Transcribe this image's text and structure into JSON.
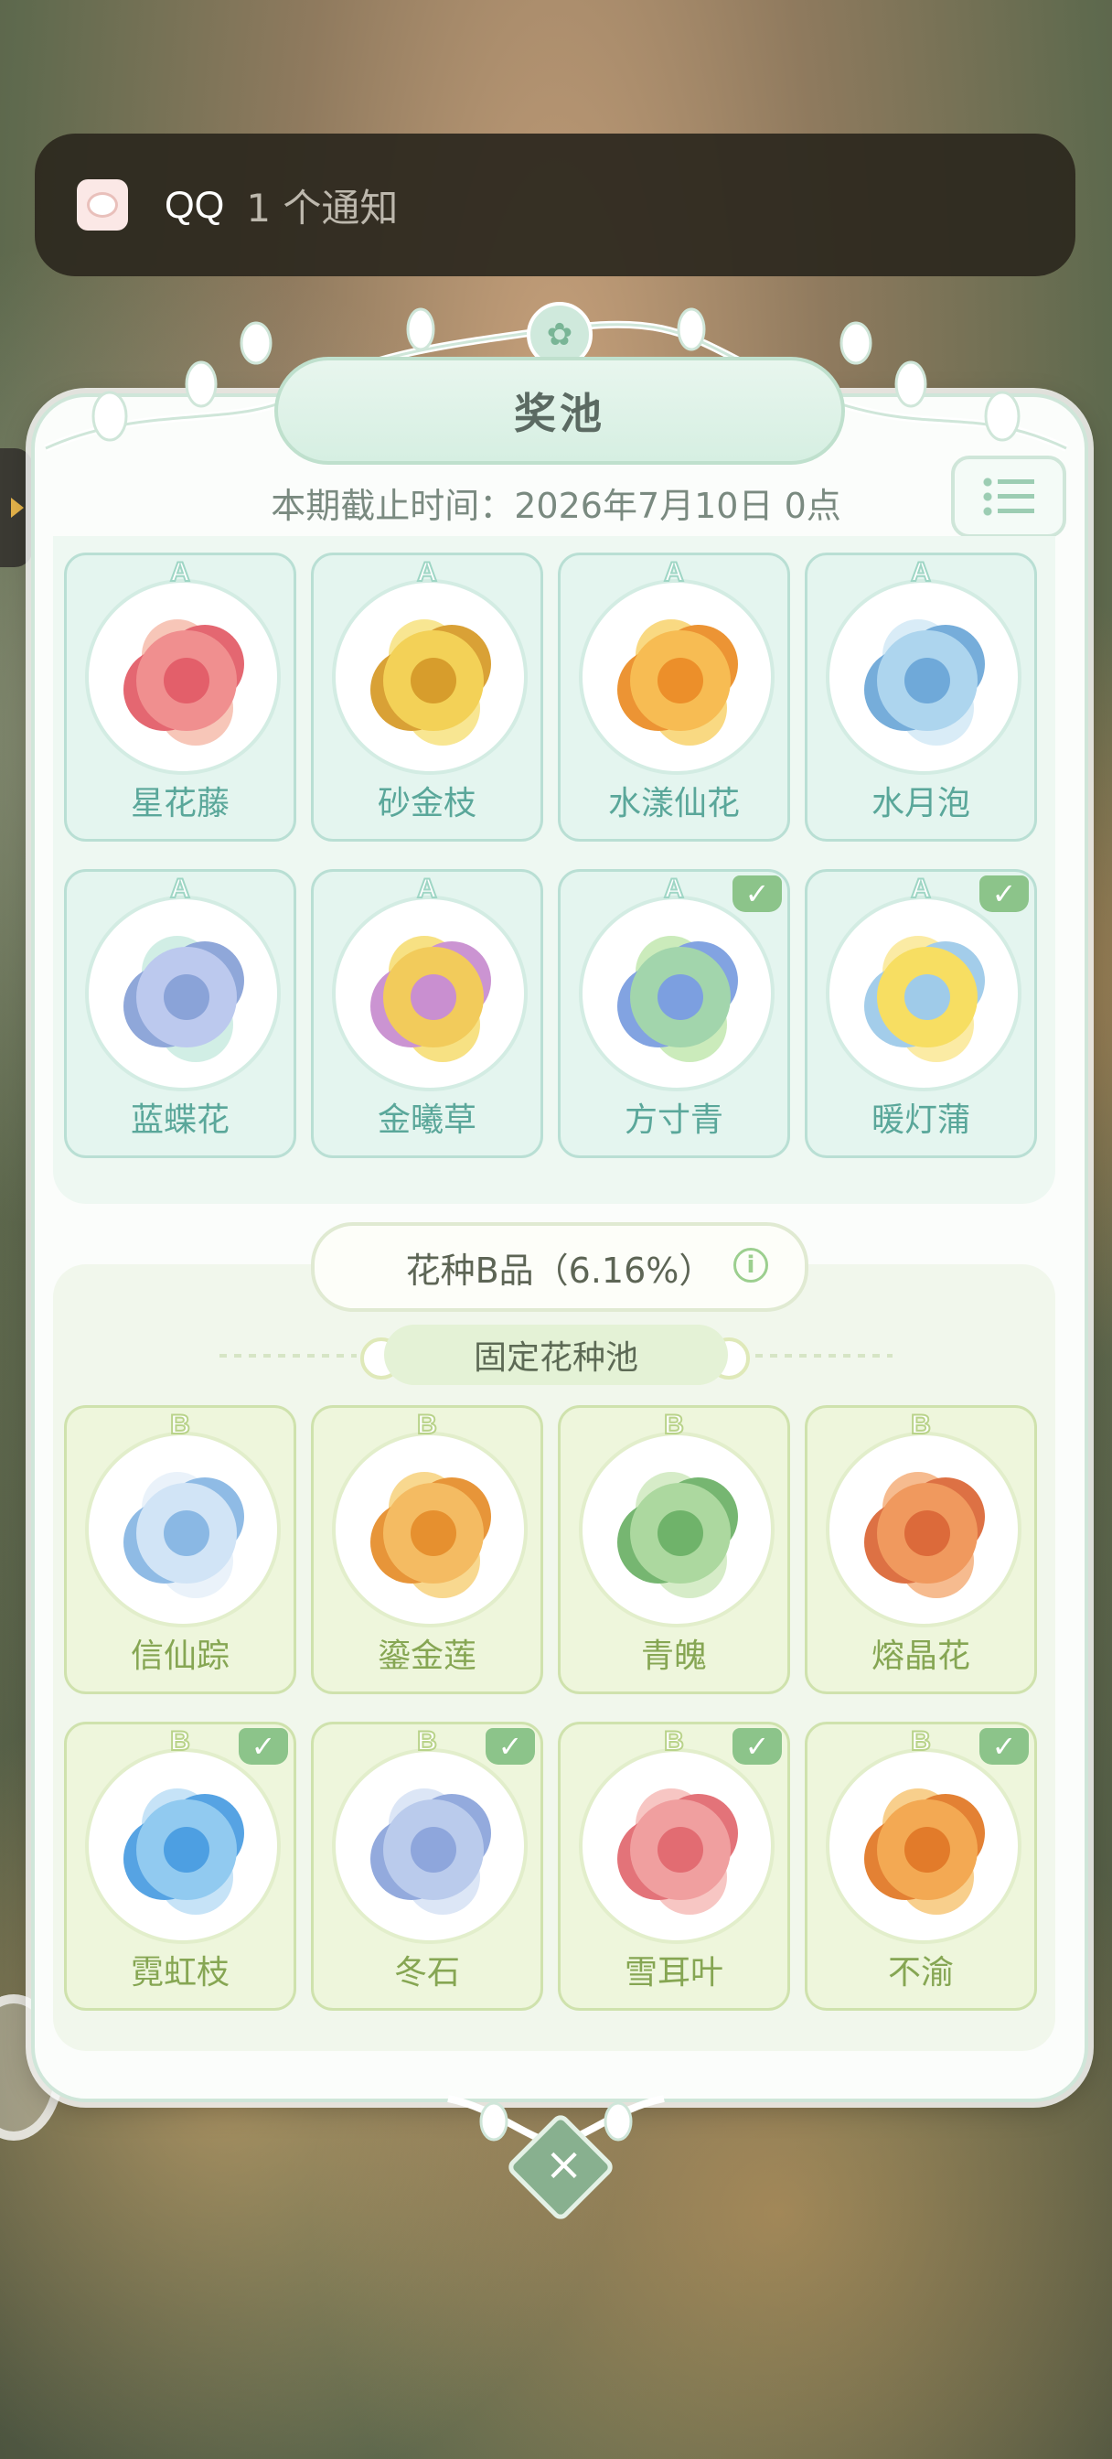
{
  "notification": {
    "app_name": "QQ",
    "text": "1 个通知"
  },
  "panel": {
    "title": "奖池",
    "deadline": "本期截止时间：2026年7月10日 0点"
  },
  "grade_a": {
    "items": [
      {
        "grade": "A",
        "name": "星花藤",
        "collected": false,
        "colors": [
          "#f08a8a",
          "#e35f6a",
          "#f7c3b5"
        ]
      },
      {
        "grade": "A",
        "name": "砂金枝",
        "collected": false,
        "colors": [
          "#f3cf4f",
          "#d79d2c",
          "#f8e58d"
        ]
      },
      {
        "grade": "A",
        "name": "水漾仙花",
        "collected": false,
        "colors": [
          "#f7b94a",
          "#ec8f2a",
          "#f9d77c"
        ]
      },
      {
        "grade": "A",
        "name": "水月泡",
        "collected": false,
        "colors": [
          "#a9d3ee",
          "#6fa9d9",
          "#d8ecf7"
        ]
      },
      {
        "grade": "A",
        "name": "蓝蝶花",
        "collected": false,
        "colors": [
          "#b9c7ee",
          "#8aa3d8",
          "#cfeee4"
        ]
      },
      {
        "grade": "A",
        "name": "金曦草",
        "collected": false,
        "colors": [
          "#f2c953",
          "#c98fd0",
          "#f7e07d"
        ]
      },
      {
        "grade": "A",
        "name": "方寸青",
        "collected": true,
        "colors": [
          "#9ed3a8",
          "#7c9fe0",
          "#c9eab8"
        ]
      },
      {
        "grade": "A",
        "name": "暖灯蒲",
        "collected": true,
        "colors": [
          "#f7dd5a",
          "#9fcbe9",
          "#fbeaa0"
        ]
      }
    ]
  },
  "grade_b": {
    "header": "花种B品（6.16%）",
    "pool_label": "固定花种池",
    "items": [
      {
        "grade": "B",
        "name": "信仙踪",
        "collected": false,
        "colors": [
          "#cfe3f6",
          "#8ab8e4",
          "#e9f2fa"
        ]
      },
      {
        "grade": "B",
        "name": "鎏金莲",
        "collected": false,
        "colors": [
          "#f4b85a",
          "#e6902f",
          "#f8d68a"
        ]
      },
      {
        "grade": "B",
        "name": "青魄",
        "collected": false,
        "colors": [
          "#a8d69a",
          "#6fb36a",
          "#d4ecc6"
        ]
      },
      {
        "grade": "B",
        "name": "熔晶花",
        "collected": false,
        "colors": [
          "#f09456",
          "#dc6a3a",
          "#f6b88a"
        ]
      },
      {
        "grade": "B",
        "name": "霓虹枝",
        "collected": true,
        "colors": [
          "#8cc8f0",
          "#4d9fe2",
          "#c3e2f7"
        ]
      },
      {
        "grade": "B",
        "name": "冬石",
        "collected": true,
        "colors": [
          "#b7c9ec",
          "#8ea6dc",
          "#dbe5f6"
        ]
      },
      {
        "grade": "B",
        "name": "雪耳叶",
        "collected": true,
        "colors": [
          "#f09a9a",
          "#e26c72",
          "#f7c4c0"
        ]
      },
      {
        "grade": "B",
        "name": "不渝",
        "collected": true,
        "colors": [
          "#f3a54a",
          "#e27b2a",
          "#f8cd86"
        ]
      }
    ]
  },
  "icons": {
    "check": "✓",
    "close": "×",
    "info": "i",
    "flower": "✿"
  }
}
